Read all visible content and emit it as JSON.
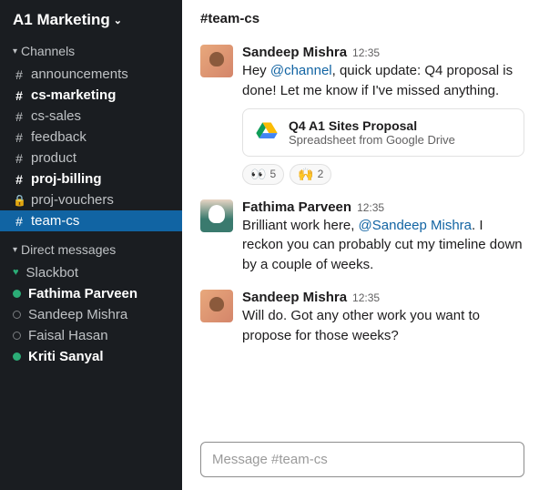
{
  "workspace": {
    "name": "A1 Marketing"
  },
  "sidebar": {
    "channels_header": "Channels",
    "dm_header": "Direct messages",
    "channels": [
      {
        "prefix": "#",
        "label": "announcements",
        "bold": false,
        "active": false,
        "locked": false
      },
      {
        "prefix": "#",
        "label": "cs-marketing",
        "bold": true,
        "active": false,
        "locked": false
      },
      {
        "prefix": "#",
        "label": "cs-sales",
        "bold": false,
        "active": false,
        "locked": false
      },
      {
        "prefix": "#",
        "label": "feedback",
        "bold": false,
        "active": false,
        "locked": false
      },
      {
        "prefix": "#",
        "label": "product",
        "bold": false,
        "active": false,
        "locked": false
      },
      {
        "prefix": "#",
        "label": "proj-billing",
        "bold": true,
        "active": false,
        "locked": false
      },
      {
        "prefix": "lock",
        "label": "proj-vouchers",
        "bold": false,
        "active": false,
        "locked": true
      },
      {
        "prefix": "#",
        "label": "team-cs",
        "bold": false,
        "active": true,
        "locked": false
      }
    ],
    "dms": [
      {
        "label": "Slackbot",
        "presence": "heart",
        "bold": false
      },
      {
        "label": "Fathima Parveen",
        "presence": "online",
        "bold": true
      },
      {
        "label": "Sandeep Mishra",
        "presence": "offline",
        "bold": false
      },
      {
        "label": "Faisal Hasan",
        "presence": "offline",
        "bold": false
      },
      {
        "label": "Kriti Sanyal",
        "presence": "online",
        "bold": true
      }
    ]
  },
  "main": {
    "channel_name": "#team-cs",
    "composer_placeholder": "Message #team-cs"
  },
  "messages": [
    {
      "author": "Sandeep Mishra",
      "time": "12:35",
      "avatar": "sandeep",
      "segments": [
        {
          "text": "Hey "
        },
        {
          "text": "@channel",
          "mention": true
        },
        {
          "text": ", quick update: Q4 proposal is done! Let me know if I've missed anything."
        }
      ],
      "attachment": {
        "title": "Q4 A1 Sites Proposal",
        "sub": "Spreadsheet from Google Drive"
      },
      "reactions": [
        {
          "emoji": "👀",
          "count": "5"
        },
        {
          "emoji": "🙌",
          "count": "2"
        }
      ]
    },
    {
      "author": "Fathima Parveen",
      "time": "12:35",
      "avatar": "fathima",
      "segments": [
        {
          "text": "Brilliant work here, "
        },
        {
          "text": "@Sandeep Mishra",
          "mention": true
        },
        {
          "text": ". I reckon you can probably cut my timeline down by a couple of weeks."
        }
      ]
    },
    {
      "author": "Sandeep Mishra",
      "time": "12:35",
      "avatar": "sandeep",
      "segments": [
        {
          "text": "Will do. Got any other work you want to propose for those weeks?"
        }
      ]
    }
  ]
}
